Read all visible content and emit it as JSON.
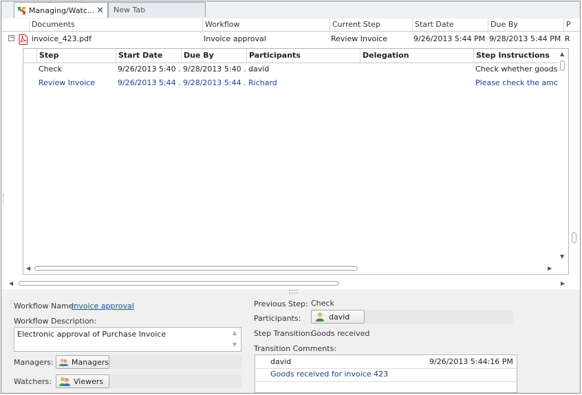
{
  "tabs": [
    {
      "label": "Managing/Watc...",
      "active": true
    },
    {
      "label": "New Tab",
      "active": false
    }
  ],
  "grid": {
    "columns": [
      "Documents",
      "Workflow",
      "Current Step",
      "Start Date",
      "Due By",
      "P"
    ],
    "rows": [
      {
        "document": "invoice_423.pdf",
        "workflow": "Invoice approval",
        "current_step": "Review Invoice",
        "start_date": "9/26/2013 5:44 PM",
        "due_by": "9/28/2013 5:44 PM",
        "p": "R"
      }
    ]
  },
  "steps_grid": {
    "columns": [
      "Step",
      "Start Date",
      "Due By",
      "Participants",
      "Delegation",
      "Step Instructions"
    ],
    "rows": [
      {
        "step": "Check",
        "start_date": "9/26/2013 5:40 ...",
        "due_by": "9/28/2013 5:40 ...",
        "participants": "david",
        "delegation": "",
        "instructions": "Check whether goods rec"
      },
      {
        "step": "Review Invoice",
        "start_date": "9/26/2013 5:44 ...",
        "due_by": "9/28/2013 5:44 ...",
        "participants": "Richard",
        "delegation": "",
        "instructions": "Please check the amount"
      }
    ]
  },
  "details": {
    "workflow_name_label": "Workflow Name:",
    "workflow_name": "Invoice approval",
    "workflow_description_label": "Workflow Description:",
    "workflow_description": "Electronic approval of Purchase Invoice",
    "managers_label": "Managers:",
    "managers_button": "Managers",
    "watchers_label": "Watchers:",
    "watchers_button": "Viewers",
    "previous_step_label": "Previous Step:",
    "previous_step": "Check",
    "participants_label": "Participants:",
    "participant": "david",
    "step_transition_label": "Step Transition:",
    "step_transition": "Goods received",
    "transition_comments_label": "Transition Comments:",
    "comment_author": "david",
    "comment_time": "9/26/2013 5:44:16 PM",
    "comment_text": "Goods received for invoice 423"
  },
  "colors": {
    "link": "#1a4ea8",
    "selected_text": "#1b3f93"
  }
}
